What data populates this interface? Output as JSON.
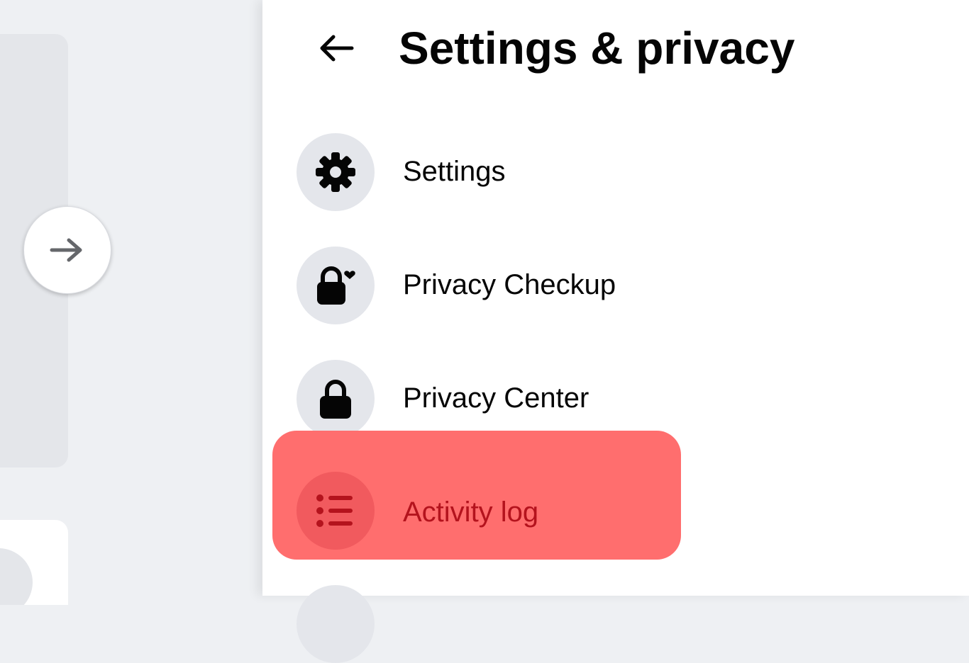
{
  "header": {
    "title": "Settings & privacy"
  },
  "menu": {
    "items": [
      {
        "label": "Settings",
        "icon": "gear-icon"
      },
      {
        "label": "Privacy Checkup",
        "icon": "lock-heart-icon"
      },
      {
        "label": "Privacy Center",
        "icon": "lock-icon"
      },
      {
        "label": "Activity log",
        "icon": "list-icon",
        "highlighted": true
      }
    ]
  },
  "colors": {
    "highlight": "#ff6e6e",
    "highlight_text": "#b4131d",
    "icon_circle": "#e4e6eb"
  }
}
